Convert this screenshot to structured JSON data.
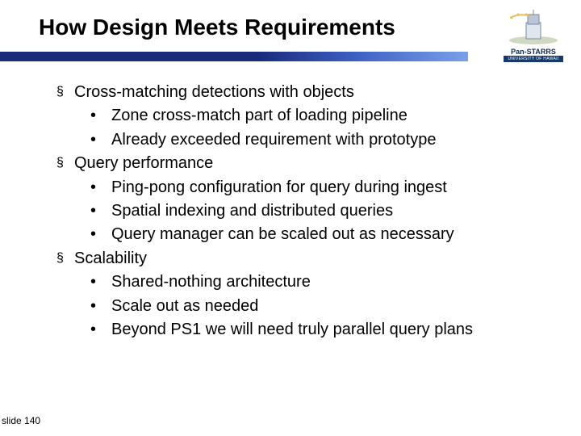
{
  "title": "How Design Meets Requirements",
  "logo": {
    "name": "Pan-STARRS",
    "sub": "UNIVERSITY OF HAWAII"
  },
  "bullets": [
    {
      "level": 1,
      "text": "Cross-matching detections with objects"
    },
    {
      "level": 2,
      "text": "Zone cross-match part of loading pipeline"
    },
    {
      "level": 2,
      "text": "Already exceeded requirement with prototype"
    },
    {
      "level": 1,
      "text": "Query performance"
    },
    {
      "level": 2,
      "text": "Ping-pong configuration for query during ingest"
    },
    {
      "level": 2,
      "text": "Spatial indexing and distributed queries"
    },
    {
      "level": 2,
      "text": "Query manager can be scaled out as necessary"
    },
    {
      "level": 1,
      "text": "Scalability"
    },
    {
      "level": 2,
      "text": "Shared-nothing architecture"
    },
    {
      "level": 2,
      "text": "Scale out as needed"
    },
    {
      "level": 2,
      "text": "Beyond PS1 we will need truly parallel query plans"
    }
  ],
  "slide_label": "slide 140",
  "markers": {
    "l1": "§",
    "l2": "•"
  }
}
